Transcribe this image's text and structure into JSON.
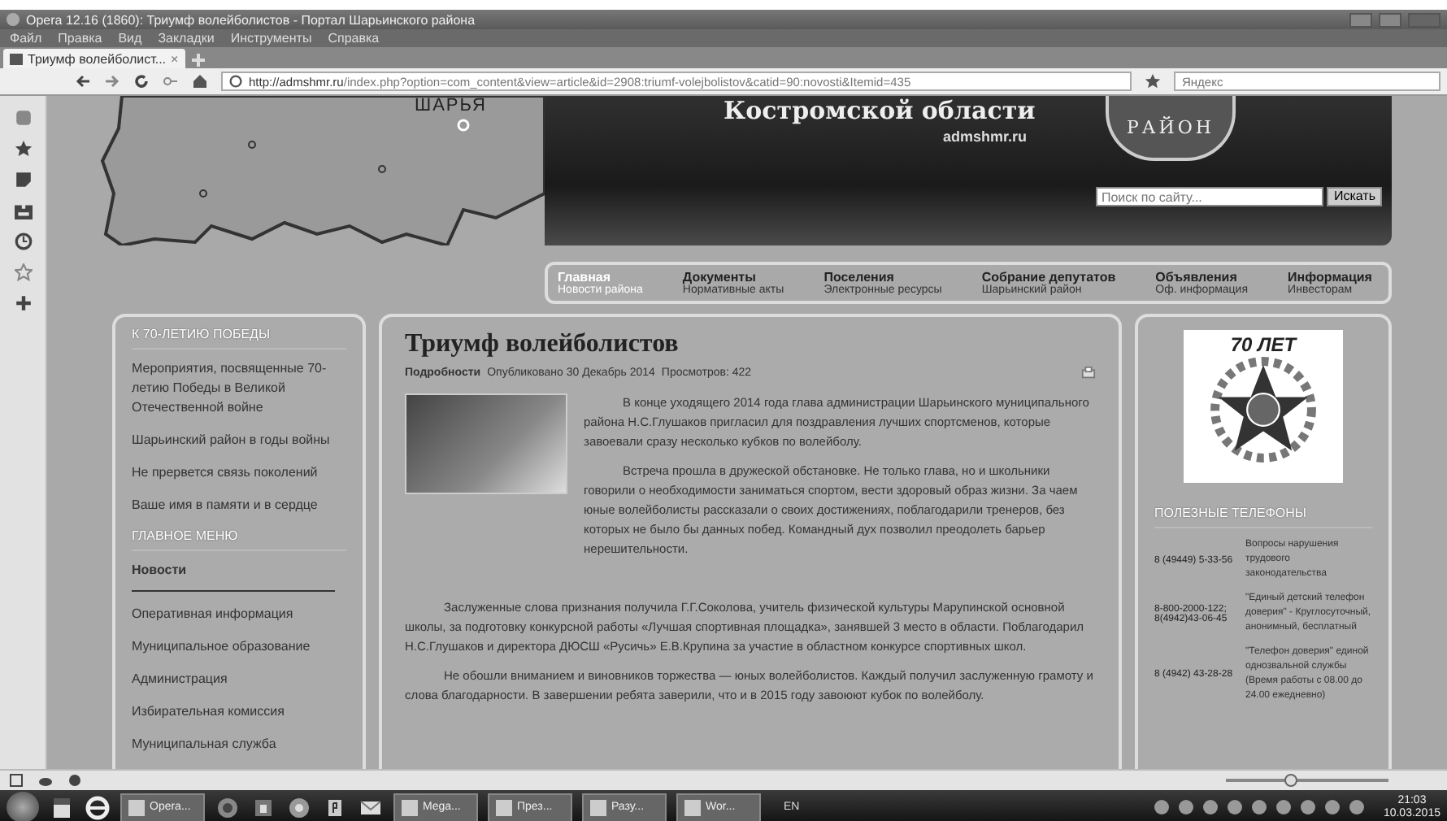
{
  "window": {
    "title": "Opera 12.16 (1860): Триумф волейболистов - Портал Шарьинского района"
  },
  "menu": [
    "Файл",
    "Правка",
    "Вид",
    "Закладки",
    "Инструменты",
    "Справка"
  ],
  "tabs": [
    {
      "label": "Триумф волейболист...",
      "close": "×",
      "selected": true
    }
  ],
  "address": {
    "host": "http://admshmr.ru",
    "path": "/index.php?option=com_content&view=article&id=2908:triumf-volejbolistov&catid=90:novosti&Itemid=435"
  },
  "search_engine": {
    "placeholder": "Яндекс"
  },
  "header": {
    "town": "ШАРЬЯ",
    "region": "Костромской области",
    "site": "admshmr.ru",
    "emblem": "РАЙОН",
    "search": {
      "placeholder": "Поиск по сайту...",
      "button": "Искать"
    }
  },
  "nav": [
    {
      "title": "Главная",
      "subtitle": "Новости района",
      "selected": true
    },
    {
      "title": "Документы",
      "subtitle": "Нормативные акты",
      "selected": false
    },
    {
      "title": "Поселения",
      "subtitle": "Электронные ресурсы",
      "selected": false
    },
    {
      "title": "Собрание депутатов",
      "subtitle": "Шарьинский район",
      "selected": false
    },
    {
      "title": "Объявления",
      "subtitle": "Оф. информация",
      "selected": false
    },
    {
      "title": "Информация",
      "subtitle": "Инвесторам",
      "selected": false
    }
  ],
  "left_menu": [
    {
      "heading": "К 70-ЛЕТИЮ ПОБЕДЫ",
      "items": [
        {
          "label": "Мероприятия, посвященные 70-летию Победы в Великой Отечественной войне",
          "selected": false
        },
        {
          "label": "Шарьинский район в годы войны",
          "selected": false
        },
        {
          "label": "Не прервется связь поколений",
          "selected": false
        },
        {
          "label": "Ваше имя в памяти и в сердце",
          "selected": false
        }
      ]
    },
    {
      "heading": "ГЛАВНОЕ МЕНЮ",
      "items": [
        {
          "label": "Новости",
          "selected": true
        },
        {
          "label": "Оперативная информация",
          "selected": false
        },
        {
          "label": "Муниципальное образование",
          "selected": false
        },
        {
          "label": "Администрация",
          "selected": false
        },
        {
          "label": "Избирательная комиссия",
          "selected": false
        },
        {
          "label": "Муниципальная служба",
          "selected": false
        }
      ]
    }
  ],
  "article": {
    "title": "Триумф волейболистов",
    "category": "Подробности",
    "published": "Опубликовано 30 Декабрь 2014",
    "views": "Просмотров: 422",
    "paragraphs": [
      "В конце уходящего 2014 года глава администрации Шарьинского муниципального района Н.С.Глушаков пригласил для поздравления лучших спортсменов, которые завоевали сразу несколько кубков по волейболу.",
      "Встреча прошла в дружеской обстановке. Не только глава, но и школьники говорили о необходимости заниматься спортом, вести здоровый образ жизни. За чаем юные волейболисты рассказали о своих достижениях, поблагодарили тренеров, без которых не было бы данных побед. Командный дух позволил преодолеть барьер нерешительности.",
      "Заслуженные слова признания получила Г.Г.Соколова, учитель физической культуры Марупинской основной школы, за подготовку конкурсной работы «Лучшая спортивная площадка», занявшей 3 место в области. Поблагодарил Н.С.Глушаков и директора ДЮСШ «Русичь» Е.В.Крупина за участие в областном конкурсе спортивных школ.",
      "Не обошли вниманием и виновников торжества — юных волейболистов. Каждый получил заслуженную грамоту и слова благодарности. В завершении ребята заверили, что и в 2015 году завоюют кубок по волейболу."
    ]
  },
  "right_panel": {
    "badge": "70 ЛЕТ",
    "heading": "ПОЛЕЗНЫЕ ТЕЛЕФОНЫ",
    "phones": [
      {
        "number": "8 (49449) 5-33-56",
        "description": "Вопросы нарушения трудового законодательства"
      },
      {
        "number": "8-800-2000-122; 8(4942)43-06-45",
        "description": "\"Единый детский телефон доверия\" - Круглосуточный, анонимный, бесплатный"
      },
      {
        "number": "8 (4942) 43-28-28",
        "description": "\"Телефон доверия\" единой однозвальной службы (Время работы с 08.00 до 24.00 ежедневно)"
      }
    ]
  },
  "status_bar": {
    "zoom": {
      "level": 0.4
    }
  },
  "taskbar": {
    "items": [
      {
        "kind": "pinned"
      },
      {
        "kind": "pinned"
      },
      {
        "kind": "window",
        "label": "Opera..."
      },
      {
        "kind": "pinned"
      },
      {
        "kind": "pinned"
      },
      {
        "kind": "pinned"
      },
      {
        "kind": "pinned"
      },
      {
        "kind": "pinned"
      },
      {
        "kind": "window",
        "label": "Mega..."
      },
      {
        "kind": "window",
        "label": "През..."
      },
      {
        "kind": "window",
        "label": "Разу..."
      },
      {
        "kind": "window",
        "label": "Wor..."
      }
    ],
    "language": "EN",
    "time": "21:03",
    "date": "10.03.2015"
  }
}
